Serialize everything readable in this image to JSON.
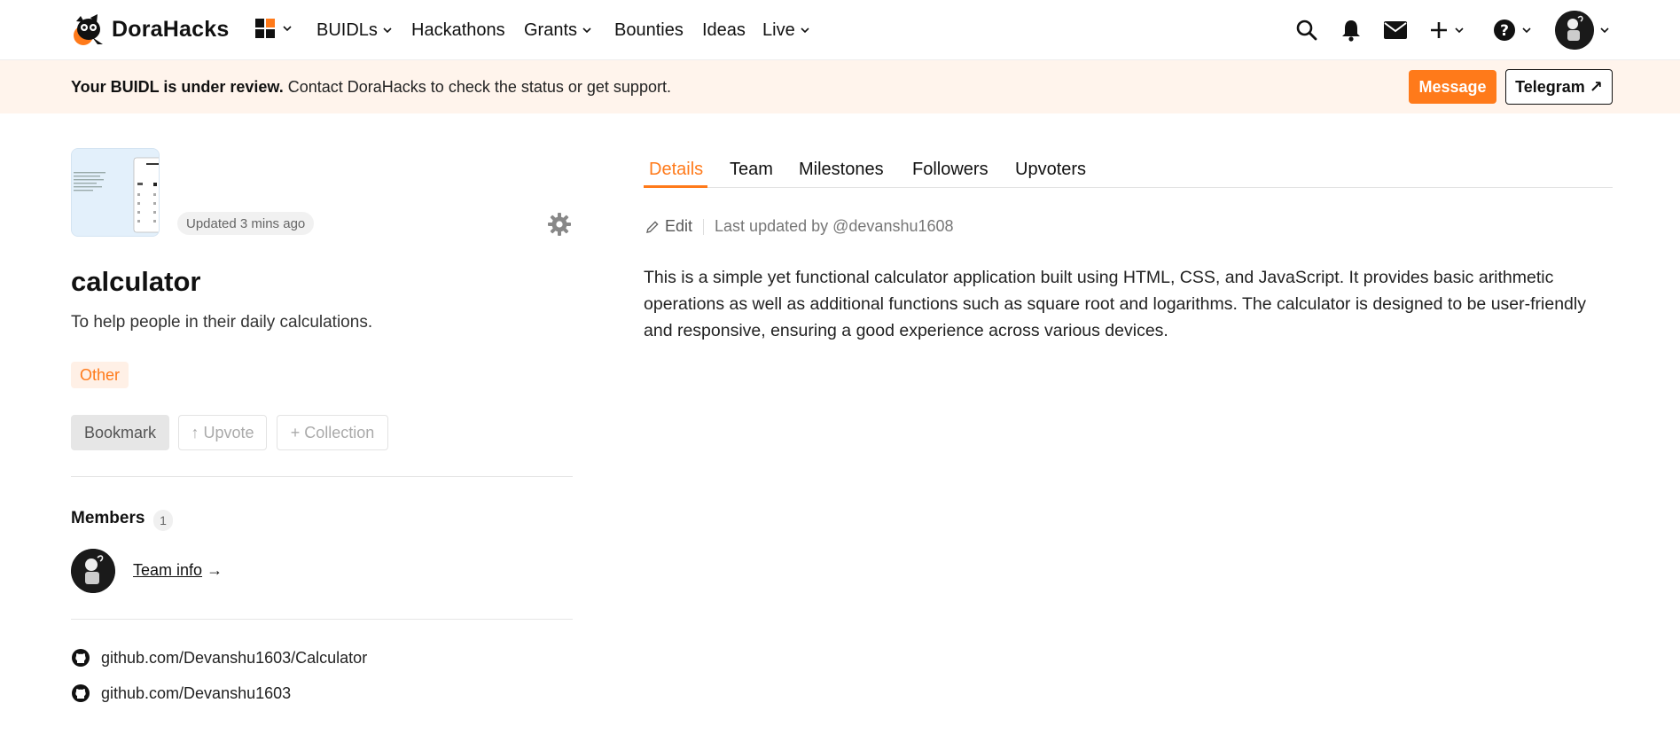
{
  "nav": {
    "brand": "DoraHacks",
    "menus": [
      {
        "label": "BUIDLs",
        "dropdown": true
      },
      {
        "label": "Hackathons",
        "dropdown": false
      },
      {
        "label": "Grants",
        "dropdown": true
      },
      {
        "label": "Bounties",
        "dropdown": false
      },
      {
        "label": "Ideas",
        "dropdown": false
      },
      {
        "label": "Live",
        "dropdown": true
      }
    ],
    "icons": [
      "apps-grid-icon",
      "search-icon",
      "bell-icon",
      "mail-icon",
      "plus-icon",
      "help-icon",
      "avatar"
    ]
  },
  "banner": {
    "bold": "Your BUIDL is under review.",
    "text": "Contact DoraHacks to check the status or get support.",
    "message_button": "Message",
    "telegram_button": "Telegram ↗"
  },
  "project": {
    "updated": "Updated 3 mins ago",
    "title": "calculator",
    "tagline": "To help people in their daily calculations.",
    "tag": "Other",
    "actions": {
      "bookmark": "Bookmark",
      "upvote": "↑ Upvote",
      "collection": "+ Collection"
    },
    "members_heading": "Members",
    "members_count": "1",
    "team_info": "Team info",
    "team_info_arrow": "→",
    "links": [
      "github.com/Devanshu1603/Calculator",
      "github.com/Devanshu1603"
    ]
  },
  "tabs": [
    "Details",
    "Team",
    "Milestones",
    "Followers",
    "Upvoters"
  ],
  "details": {
    "edit_label": "Edit",
    "last_updated": "Last updated by @devanshu1608",
    "description": "This is a simple yet functional calculator application built using HTML, CSS, and JavaScript. It provides basic arithmetic operations as well as additional functions such as square root and logarithms. The calculator is designed to be user-friendly and responsive, ensuring a good experience across various devices."
  },
  "colors": {
    "accent": "#ff7a1a",
    "banner_bg": "#fff4ec",
    "tag_bg": "#fff0e6"
  }
}
